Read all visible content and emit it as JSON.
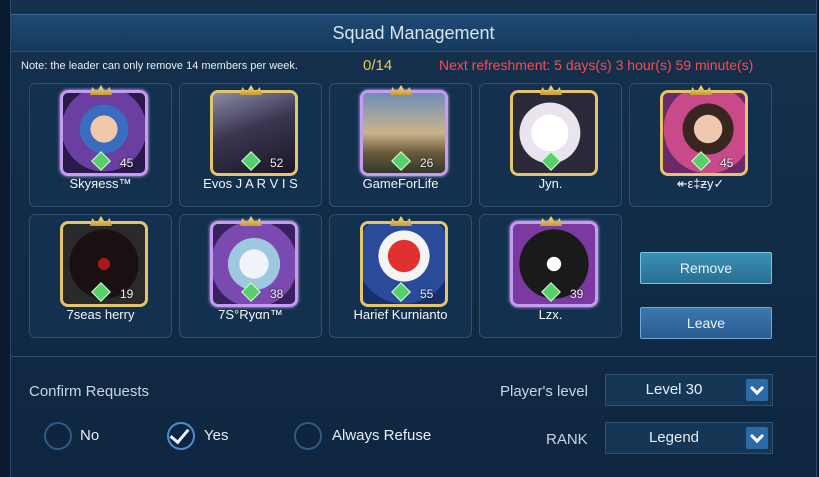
{
  "title": "Squad Management",
  "note": "Note: the leader can only remove 14 members per week.",
  "removal_count": "0/14",
  "refresh_text": "Next refreshment: 5 days(s) 3 hour(s) 59 minute(s)",
  "members": [
    {
      "name": "Skyяess™",
      "level": "45"
    },
    {
      "name": "Evos J A R V I S",
      "level": "52"
    },
    {
      "name": "GameForLife",
      "level": "26"
    },
    {
      "name": "Jyn.",
      "level": ""
    },
    {
      "name": "↞ε‡ƶy✓",
      "level": "45"
    },
    {
      "name": "7seas herry",
      "level": "19"
    },
    {
      "name": "7S°Ryαn™",
      "level": "38"
    },
    {
      "name": "Harief Kurnianto",
      "level": "55"
    },
    {
      "name": "Lzx.",
      "level": "39"
    }
  ],
  "buttons": {
    "remove": "Remove",
    "leave": "Leave"
  },
  "confirm": {
    "label": "Confirm Requests",
    "options": [
      "No",
      "Yes",
      "Always Refuse"
    ],
    "selected": "Yes"
  },
  "player_level": {
    "label": "Player's level",
    "value": "Level 30"
  },
  "rank": {
    "label": "RANK",
    "value": "Legend"
  },
  "colors": {
    "countdown": "#ff4a4a",
    "count": "#f0c84a",
    "accent": "#2b6aa8"
  },
  "icons": {
    "check": "check-icon",
    "dropdown": "chevron-down-icon",
    "badge": "diamond-icon",
    "frame": "crown-icon"
  }
}
